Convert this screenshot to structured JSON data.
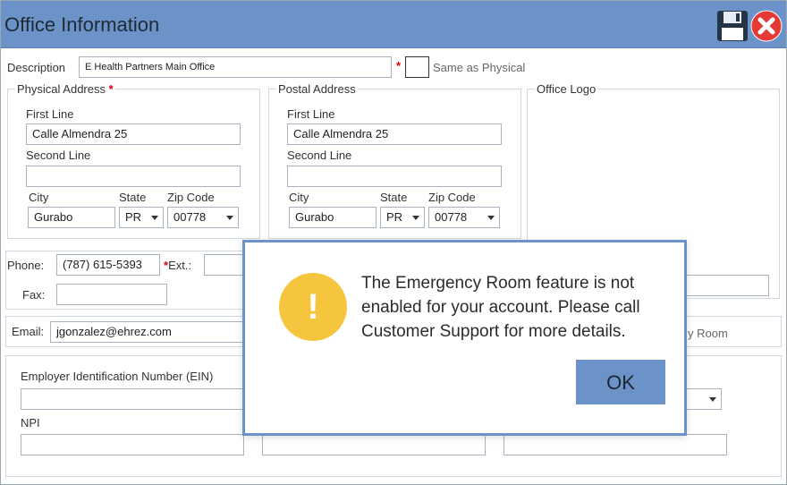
{
  "window": {
    "title": "Office Information"
  },
  "icons": {
    "save": "save-icon",
    "close": "close-icon",
    "warning": "warning-icon"
  },
  "form": {
    "description": {
      "label": "Description",
      "value": "E Health Partners Main Office",
      "required_mark": "*"
    },
    "same_as_physical": {
      "label": "Same as Physical",
      "checked": false
    },
    "physical": {
      "title": "Physical Address",
      "required_mark": "*",
      "first_line_label": "First Line",
      "first_line": "Calle Almendra 25",
      "second_line_label": "Second Line",
      "second_line": "",
      "city_label": "City",
      "city": "Gurabo",
      "state_label": "State",
      "state": "PR",
      "zip_label": "Zip Code",
      "zip": "00778"
    },
    "postal": {
      "title": "Postal Address",
      "first_line_label": "First Line",
      "first_line": "Calle Almendra 25",
      "second_line_label": "Second Line",
      "second_line": "",
      "city_label": "City",
      "city": "Gurabo",
      "state_label": "State",
      "state": "PR",
      "zip_label": "Zip Code",
      "zip": "00778"
    },
    "logo": {
      "title": "Office Logo"
    },
    "phone": {
      "label": "Phone:",
      "value": "(787) 615-5393",
      "ext_required_mark": "*",
      "ext_label": "Ext.:",
      "ext": ""
    },
    "fax": {
      "label": "Fax:",
      "value": ""
    },
    "email": {
      "label": "Email:",
      "value": "jgonzalez@ehrez.com"
    },
    "room_fragment": "y Room",
    "ein": {
      "label": "Employer Identification Number (EIN)",
      "value": ""
    },
    "npi": {
      "label": "NPI",
      "value": ""
    }
  },
  "dialog": {
    "message": "The Emergency Room feature is not enabled for your account. Please call Customer Support for more details.",
    "icon_glyph": "!",
    "ok_label": "OK"
  },
  "colors": {
    "title_bar": "#6b93c8",
    "dialog_border": "#6b93c8",
    "warning": "#f6c53e",
    "close": "#e53935",
    "required": "#d40000"
  }
}
